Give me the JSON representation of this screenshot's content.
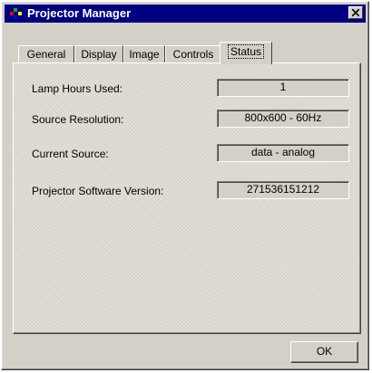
{
  "window": {
    "title": "Projector Manager",
    "app_icon": "projector-manager-icon",
    "close_icon": "close-icon"
  },
  "tabs": [
    {
      "label": "General"
    },
    {
      "label": "Display"
    },
    {
      "label": "Image"
    },
    {
      "label": "Controls"
    },
    {
      "label": "Status",
      "active": true
    }
  ],
  "status": {
    "rows": [
      {
        "label": "Lamp Hours Used:",
        "value": "1"
      },
      {
        "label": "Source Resolution:",
        "value": "800x600 - 60Hz"
      },
      {
        "label": "Current Source:",
        "value": "data - analog"
      },
      {
        "label": "Projector Software Version:",
        "value": "271536151212"
      }
    ]
  },
  "footer": {
    "ok_label": "OK"
  },
  "colors": {
    "titlebar": "#000080",
    "face": "#d4d0c8"
  }
}
